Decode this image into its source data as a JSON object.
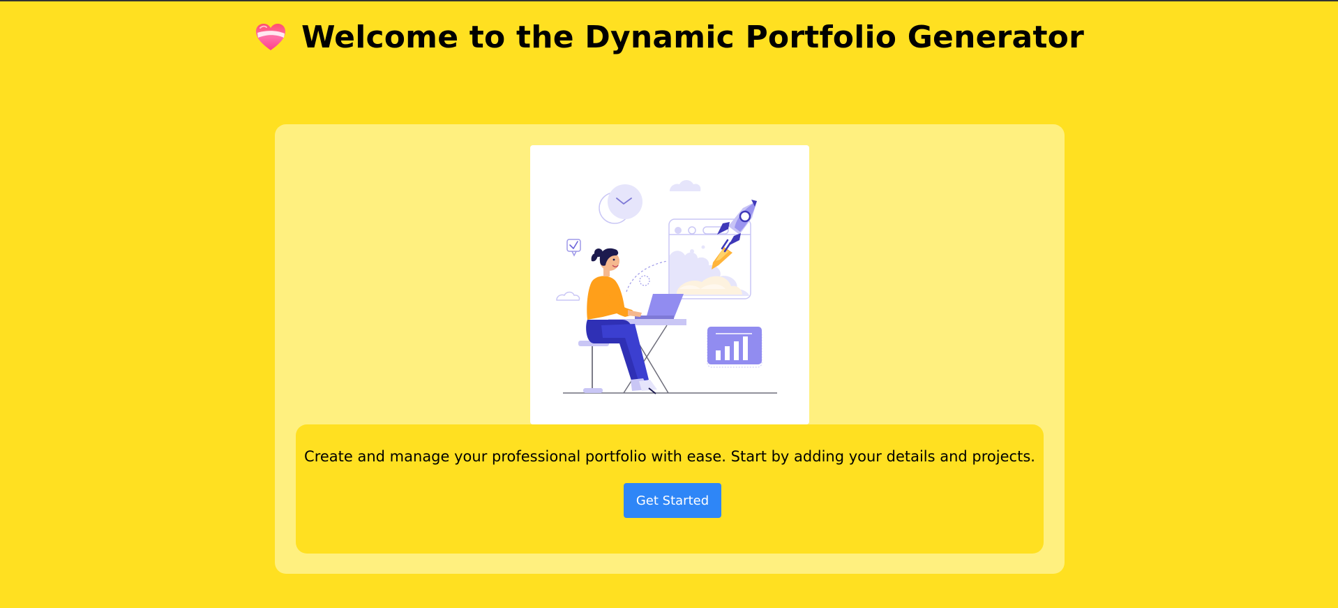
{
  "header": {
    "icon": "heart-icon",
    "title": "Welcome to the Dynamic Portfolio Generator"
  },
  "hero": {
    "illustration": "person-at-laptop-rocket-launch-illustration"
  },
  "intro": {
    "description": "Create and manage your professional portfolio with ease. Start by adding your details and projects.",
    "cta_label": "Get Started"
  },
  "colors": {
    "page_background": "#ffe021",
    "card_background": "#fff07f",
    "button": "#2e86f7"
  }
}
